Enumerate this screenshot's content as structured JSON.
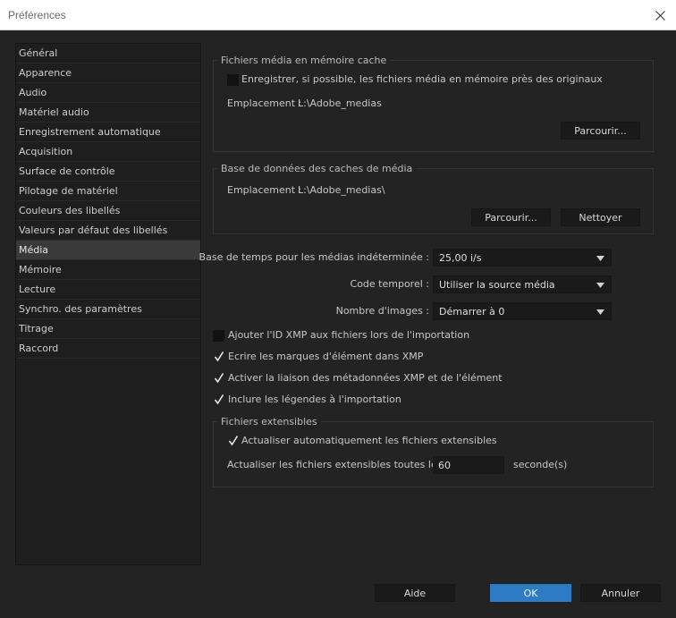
{
  "window": {
    "title": "Préférences"
  },
  "sidebar": {
    "items": [
      {
        "label": "Général"
      },
      {
        "label": "Apparence"
      },
      {
        "label": "Audio"
      },
      {
        "label": "Matériel audio"
      },
      {
        "label": "Enregistrement automatique"
      },
      {
        "label": "Acquisition"
      },
      {
        "label": "Surface de contrôle"
      },
      {
        "label": "Pilotage de matériel"
      },
      {
        "label": "Couleurs des libellés"
      },
      {
        "label": "Valeurs par défaut des libellés"
      },
      {
        "label": "Média"
      },
      {
        "label": "Mémoire"
      },
      {
        "label": "Lecture"
      },
      {
        "label": "Synchro. des paramètres"
      },
      {
        "label": "Titrage"
      },
      {
        "label": "Raccord"
      }
    ],
    "selected_index": 10
  },
  "media_cache_files": {
    "title": "Fichiers média en mémoire cache",
    "save_near_originals": {
      "label": "Enregistrer, si possible, les fichiers média en mémoire près des originaux",
      "checked": false
    },
    "location_label": "Emplacement :",
    "location_value": "L:\\Adobe_medias",
    "browse_label": "Parcourir..."
  },
  "media_cache_db": {
    "title": "Base de données des caches de média",
    "location_label": "Emplacement :",
    "location_value": "L:\\Adobe_medias\\",
    "browse_label": "Parcourir...",
    "clean_label": "Nettoyer"
  },
  "settings": {
    "timebase": {
      "label": "Base de temps pour les médias indéterminée :",
      "value": "25,00 i/s"
    },
    "timecode": {
      "label": "Code temporel :",
      "value": "Utiliser la source média"
    },
    "frame_count": {
      "label": "Nombre d'images :",
      "value": "Démarrer à 0"
    }
  },
  "checkboxes": {
    "xmp_id": {
      "label": "Ajouter l'ID XMP aux fichiers lors de l'importation",
      "checked": false
    },
    "clip_markers": {
      "label": "Ecrire les marques d'élément dans XMP",
      "checked": true
    },
    "metadata_link": {
      "label": "Activer la liaison des métadonnées XMP et de l'élément",
      "checked": true
    },
    "captions": {
      "label": "Inclure les légendes à l'importation",
      "checked": true
    }
  },
  "growing_files": {
    "title": "Fichiers extensibles",
    "auto_refresh": {
      "label": "Actualiser automatiquement les fichiers extensibles",
      "checked": true
    },
    "interval_label": "Actualiser les fichiers extensibles toutes les",
    "interval_value": "60",
    "interval_unit": "seconde(s)"
  },
  "footer": {
    "help_label": "Aide",
    "ok_label": "OK",
    "cancel_label": "Annuler"
  },
  "colors": {
    "accent": "#2d7bc2",
    "background": "#232323",
    "selected_item": "#3a3a3a"
  }
}
